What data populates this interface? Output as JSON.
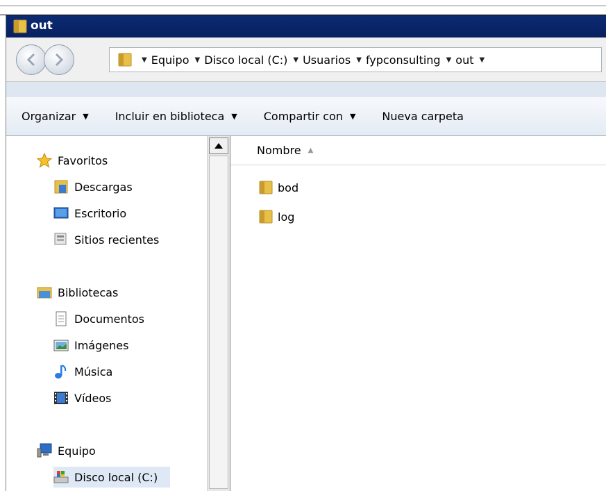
{
  "window": {
    "title": "out"
  },
  "address": {
    "crumbs": [
      "Equipo",
      "Disco local (C:)",
      "Usuarios",
      "fypconsulting",
      "out"
    ]
  },
  "toolbar": {
    "organize": "Organizar",
    "include_library": "Incluir en biblioteca",
    "share_with": "Compartir con",
    "new_folder": "Nueva carpeta"
  },
  "sidebar": {
    "favorites": {
      "label": "Favoritos",
      "items": [
        "Descargas",
        "Escritorio",
        "Sitios recientes"
      ]
    },
    "libraries": {
      "label": "Bibliotecas",
      "items": [
        "Documentos",
        "Imágenes",
        "Música",
        "Vídeos"
      ]
    },
    "computer": {
      "label": "Equipo",
      "items": [
        "Disco local (C:)"
      ]
    }
  },
  "content": {
    "column_name": "Nombre",
    "files": [
      "bod",
      "log"
    ]
  },
  "colors": {
    "title_bg": "#0a246a",
    "folder": "#e8c048",
    "selected": "#dfe9f5"
  }
}
